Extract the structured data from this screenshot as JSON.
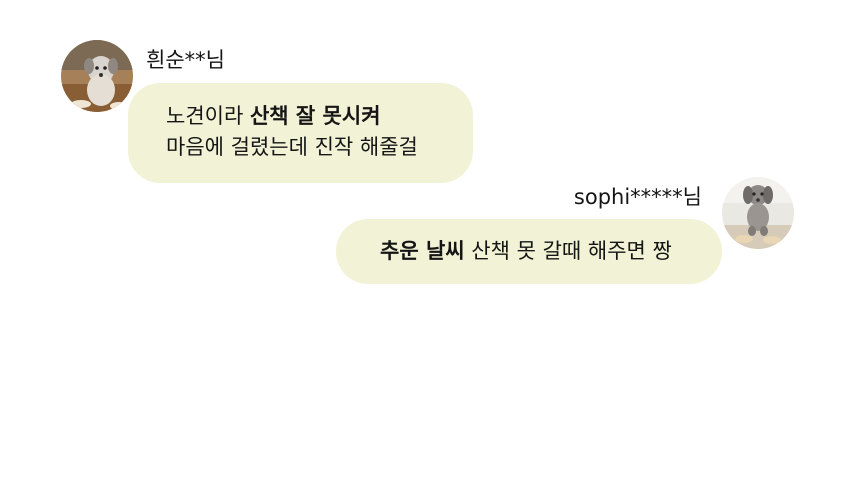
{
  "messages": [
    {
      "username": "흰순**님",
      "avatar": "dog-photo-avatar",
      "text": {
        "line1_normal": "노견이라 ",
        "line1_bold": "산책 잘 못시켜",
        "line2": "마음에 걸렸는데 진작 해줄걸"
      }
    },
    {
      "username": "sophi*****님",
      "avatar": "dog-photo-avatar",
      "text": {
        "bold": "추운 날씨",
        "normal": " 산책 못 갈때 해주면 짱"
      }
    }
  ],
  "colors": {
    "bubble": "#f2f3d6",
    "text": "#151515"
  }
}
